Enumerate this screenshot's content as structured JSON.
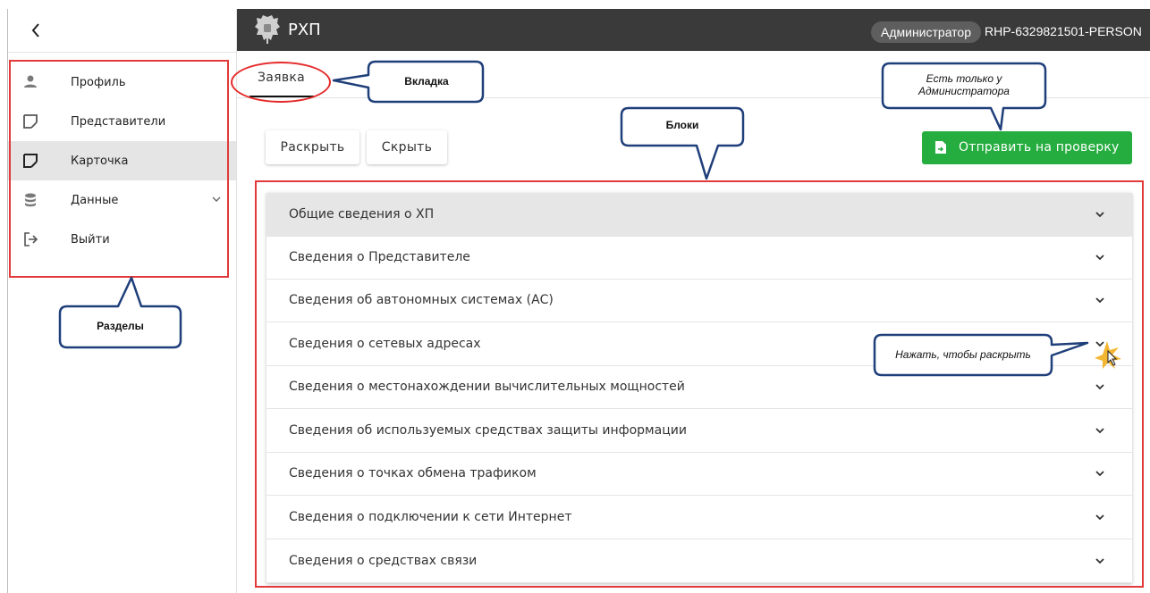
{
  "sidebar": {
    "items": [
      {
        "label": "Профиль",
        "icon": "person-icon"
      },
      {
        "label": "Представители",
        "icon": "edit-note-icon"
      },
      {
        "label": "Карточка",
        "icon": "edit-note-icon"
      },
      {
        "label": "Данные",
        "icon": "database-icon"
      },
      {
        "label": "Выйти",
        "icon": "logout-icon"
      }
    ]
  },
  "header": {
    "title": "РХП",
    "role": "Администратор",
    "user_id": "RHP-6329821501-PERSON"
  },
  "tabs": [
    {
      "label": "Заявка"
    }
  ],
  "actions": {
    "expand": "Раскрыть",
    "collapse": "Скрыть",
    "send": "Отправить на проверку"
  },
  "accordion": {
    "items": [
      "Общие сведения о ХП",
      "Сведения о Представителе",
      "Сведения об автономных системах (АС)",
      "Сведения о сетевых адресах",
      "Сведения о местонахождении вычислительных мощностей",
      "Сведения об используемых средствах защиты информации",
      "Сведения о точках обмена трафиком",
      "Сведения о подключении к сети Интернет",
      "Сведения о средствах связи"
    ]
  },
  "annotations": {
    "tab": "Вкладка",
    "blocks": "Блоки",
    "admin_only": "Есть только у Администратора",
    "sections": "Разделы",
    "click_hint": "Нажать, чтобы раскрыть"
  },
  "colors": {
    "topbar": "#3a3a3a",
    "send_button": "#25ad3f",
    "annotation_red": "#e23a3a",
    "callout_border": "#1f3f7a"
  }
}
